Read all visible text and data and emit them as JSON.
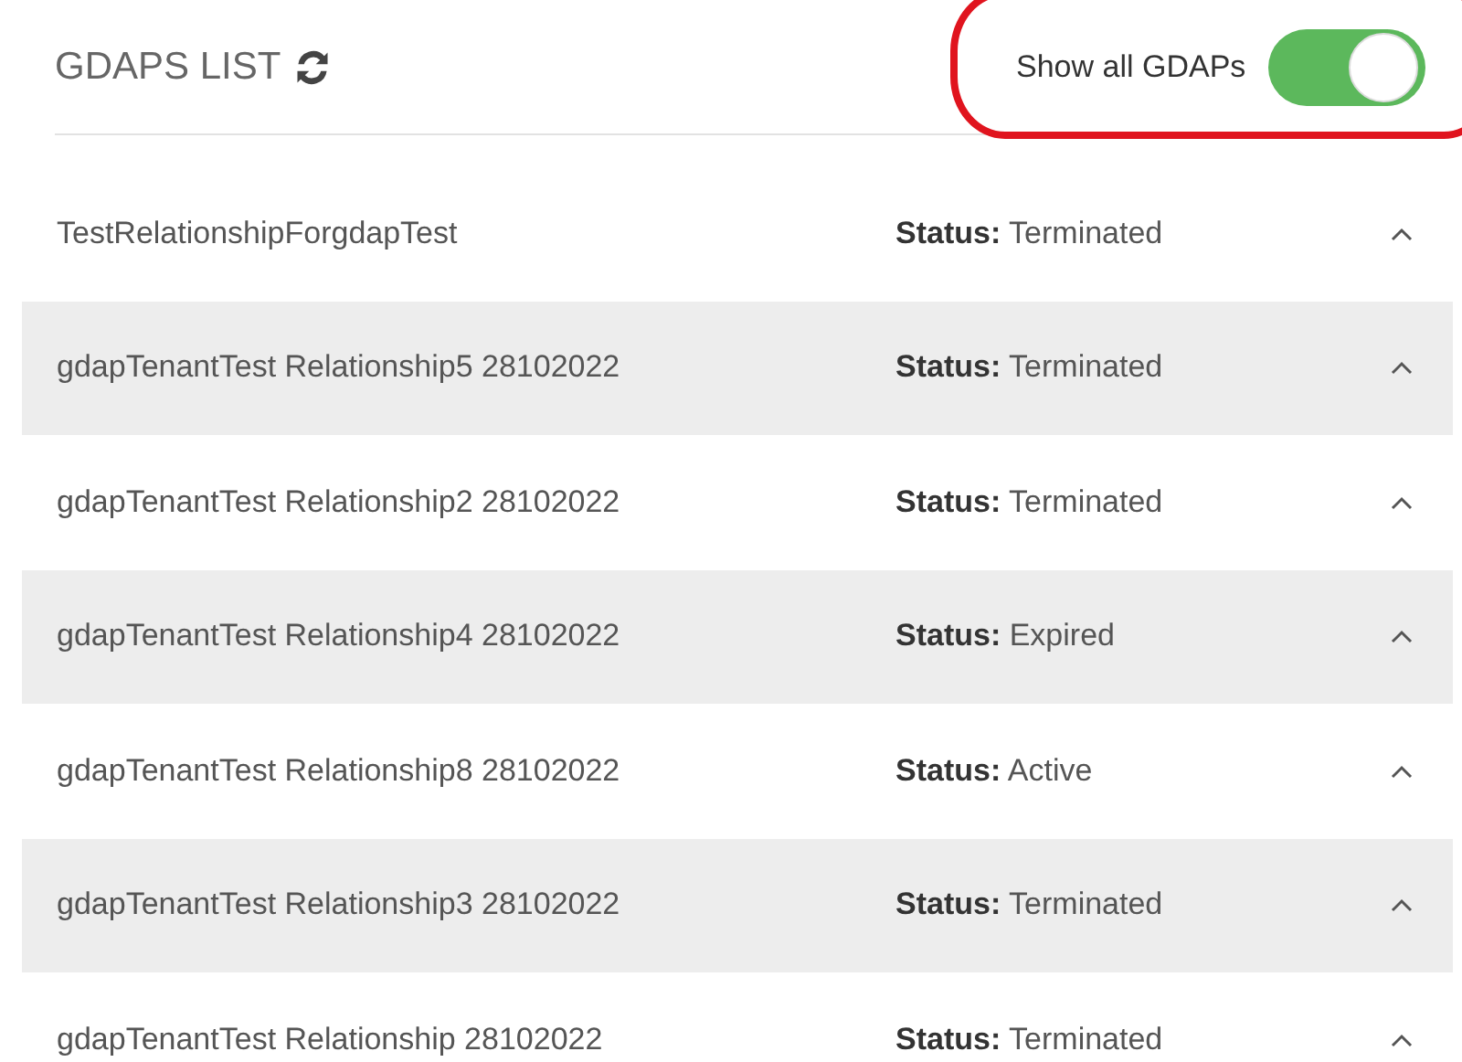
{
  "header": {
    "title": "GDAPS LIST",
    "toggle": {
      "label": "Show all GDAPs",
      "on": true,
      "highlighted": true
    }
  },
  "rows": [
    {
      "name": "TestRelationshipForgdapTest",
      "status": "**Status:** Terminated",
      "expanded": false
    },
    {
      "name": "gdapTenantTest Relationship5 28102022",
      "status": "**Status:** Terminated",
      "expanded": false
    },
    {
      "name": "gdapTenantTest Relationship2 28102022",
      "status": "**Status:** Terminated",
      "expanded": false
    },
    {
      "name": "gdapTenantTest Relationship4 28102022",
      "status": "**Status:** Expired",
      "expanded": false
    },
    {
      "name": "gdapTenantTest Relationship8 28102022",
      "status": "**Status:** Active",
      "expanded": false
    },
    {
      "name": "gdapTenantTest Relationship3 28102022",
      "status": "**Status:** Terminated",
      "expanded": false
    },
    {
      "name": "gdapTenantTest Relationship 28102022",
      "status": "**Status:** Terminated",
      "expanded": false
    }
  ]
}
